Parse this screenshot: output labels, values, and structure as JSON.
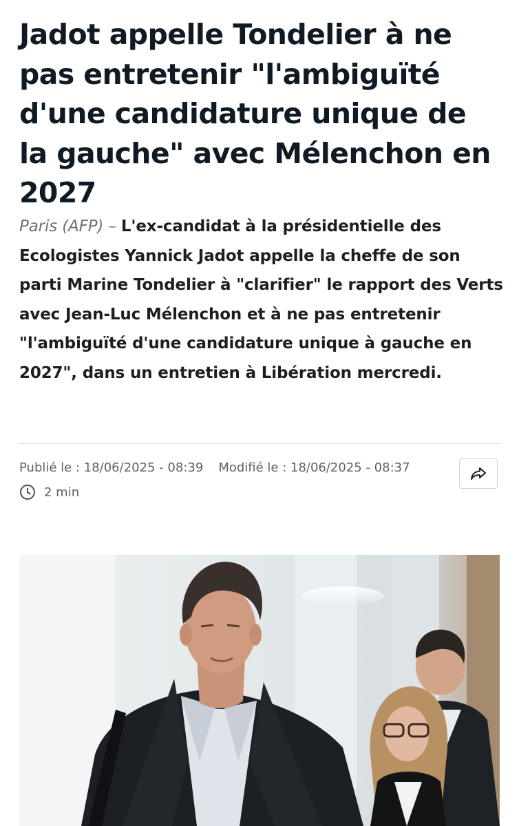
{
  "article": {
    "headline": "Jadot appelle Tondelier à ne pas entretenir \"l'ambiguïté d'une candidature unique de la gauche\" avec Mélenchon en 2027",
    "dateline": "Paris (AFP)",
    "dateline_dash": " – ",
    "lead": "L'ex-candidat à la présidentielle des Ecologistes Yannick Jadot appelle la cheffe de son parti Marine Tondelier à \"clarifier\" le rapport des Verts avec Jean-Luc Mélenchon et à ne pas entretenir \"l'ambiguïté d'une candidature unique à gauche en 2027\", dans un entretien à Libération mercredi."
  },
  "meta": {
    "published": "Publié le : 18/06/2025 - 08:39",
    "modified": "Modifié le : 18/06/2025 - 08:37",
    "read_time": "2 min"
  },
  "icons": {
    "clock": "clock-icon",
    "share": "share-arrow-icon"
  },
  "colors": {
    "headline": "#0f1a24",
    "meta_text": "#5c6269",
    "divider": "#d9dcdf"
  }
}
